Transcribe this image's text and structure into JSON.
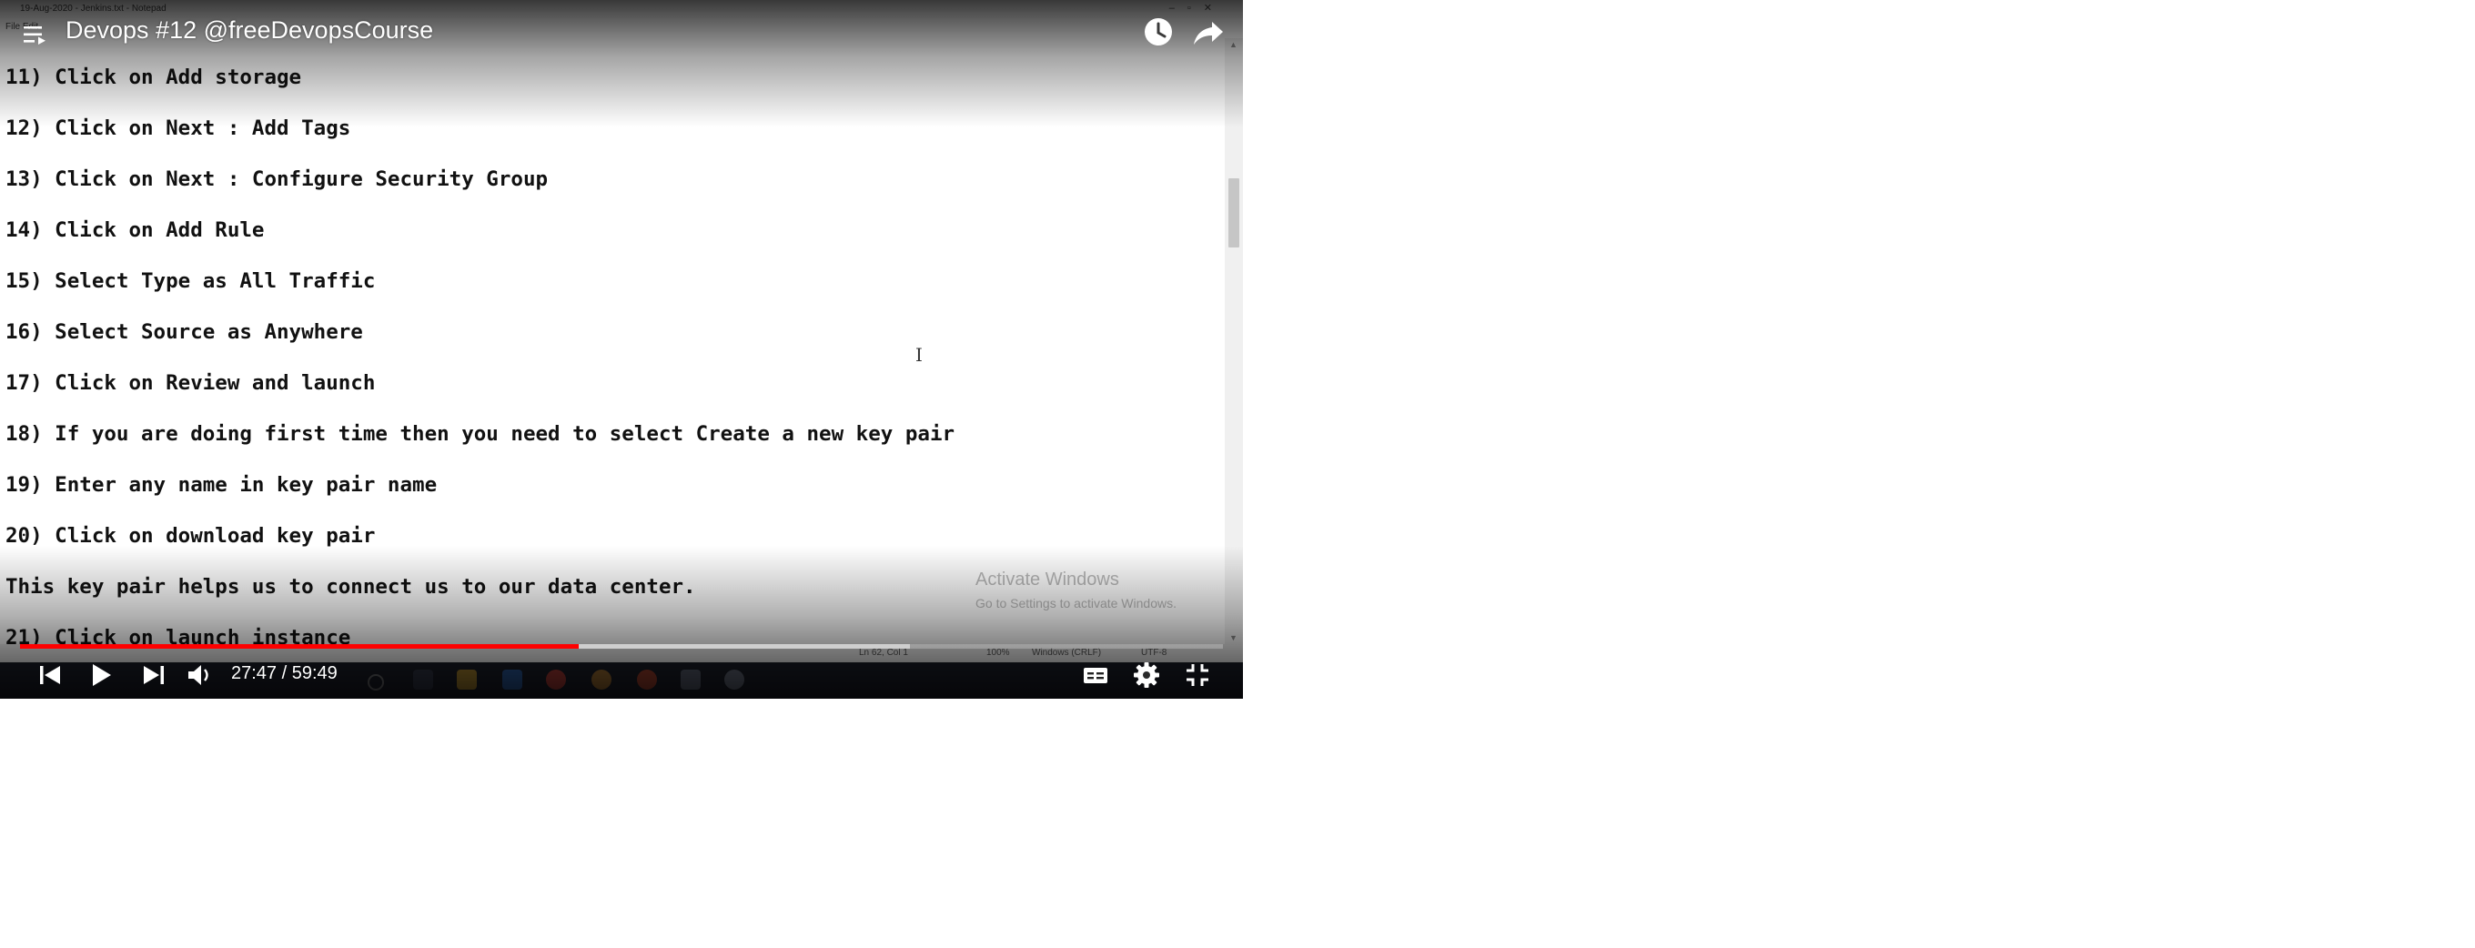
{
  "video": {
    "title": "Devops #12 @freeDevopsCourse",
    "current_time": "27:47",
    "duration": "59:49",
    "played_fraction": 0.4645,
    "buffered_fraction": 0.74
  },
  "notepad": {
    "window_title": "19-Aug-2020 - Jenkins.txt - Notepad",
    "menu_text": "File Edit",
    "lines": [
      "11) Click on Add storage",
      "12) Click on Next : Add Tags",
      "13) Click on Next : Configure Security Group",
      "14) Click on Add Rule",
      "15) Select Type as All Traffic",
      "16) Select Source as Anywhere",
      "17) Click on Review and launch",
      "18) If you are doing first time then you need to select Create a new key pair",
      "19) Enter any name in key pair name",
      "20) Click on download key pair",
      "This key pair helps us to connect us to our data center.",
      "21) Click on launch instance"
    ],
    "status": {
      "position": "Ln 62, Col 1",
      "zoom": "100%",
      "line_ending": "Windows (CRLF)",
      "encoding": "UTF-8"
    },
    "watermark": {
      "title": "Activate Windows",
      "subtitle": "Go to Settings to activate Windows."
    }
  },
  "icons": {
    "playlist": "playlist-icon",
    "watch_later": "clock-icon",
    "share": "share-arrow-icon",
    "previous": "skip-previous-icon",
    "play": "play-icon",
    "next": "skip-next-icon",
    "volume": "speaker-icon",
    "captions": "cc-icon",
    "settings": "gear-icon",
    "exit_fullscreen": "exit-fullscreen-icon"
  },
  "colors": {
    "progress_played": "#ff0000",
    "overlay_text": "#ffffff",
    "notepad_text": "#111111"
  }
}
